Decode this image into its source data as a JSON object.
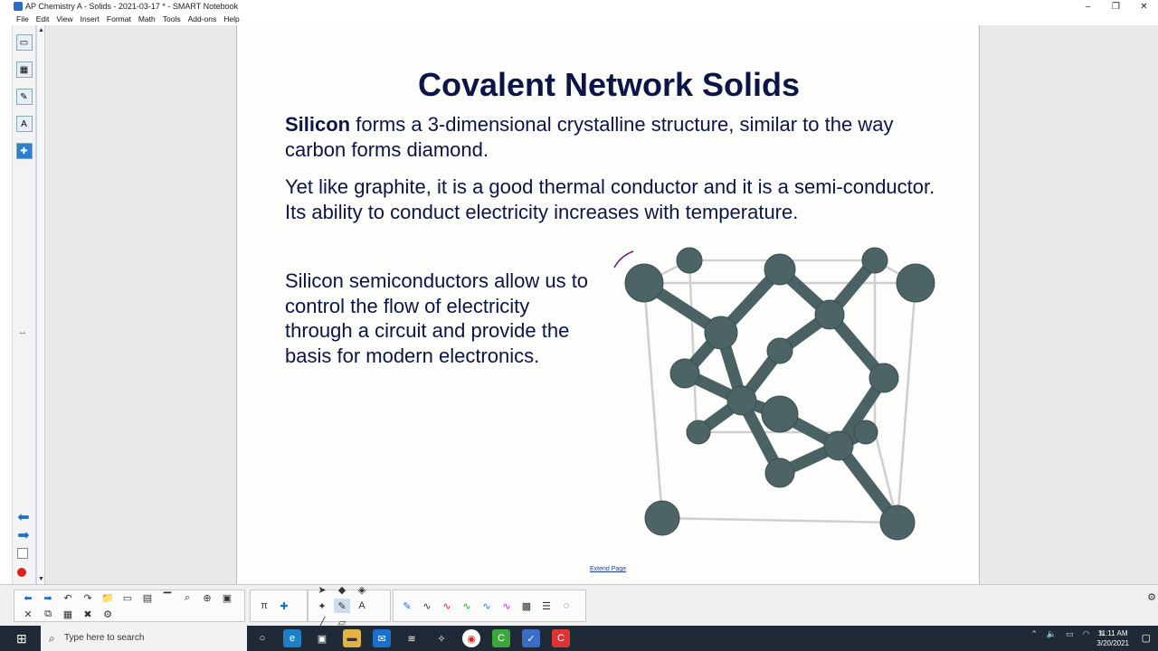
{
  "window": {
    "title": "AP Chemistry A -  Solids - 2021-03-17 * - SMART Notebook",
    "minimize": "–",
    "restore": "❐",
    "close": "✕"
  },
  "menu": [
    "File",
    "Edit",
    "View",
    "Insert",
    "Format",
    "Math",
    "Tools",
    "Add-ons",
    "Help"
  ],
  "slide": {
    "title": "Covalent Network Solids",
    "p1_bold": "Silicon",
    "p1_rest": " forms a 3-dimensional crystalline structure, similar to the way carbon forms diamond.",
    "p2": "Yet like graphite, it is a good thermal conductor and it is a semi-conductor. Its ability to conduct electricity increases with temperature.",
    "p3": "Silicon semiconductors allow us to control the flow of electricity through a circuit and provide the basis for modern electronics.",
    "extend_page": "Extend Page"
  },
  "taskbar": {
    "search_placeholder": "Type here to search",
    "time": "11:11 AM",
    "date": "3/20/2021"
  },
  "colors": {
    "title_text": "#0c1548",
    "atom": "#4d6466",
    "workspace": "#e9e9e9",
    "taskbar": "#1f2a36"
  }
}
